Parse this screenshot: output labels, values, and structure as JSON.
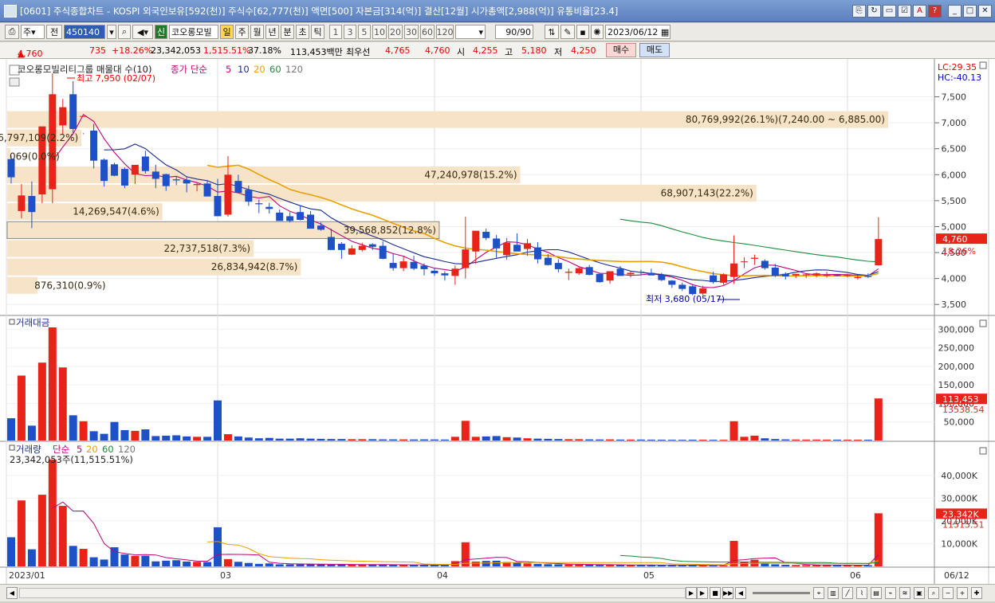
{
  "title": "[0601] 주식종합차트 - KOSPI 외국인보유[592(천)] 주식수[62,777(천)] 액면[500] 자본금[314(억)] 결산[12월] 시가총액[2,988(억)] 유통비율[23.4]",
  "toolbar": {
    "jumun": "주",
    "jeon": "전",
    "code": "450140",
    "market_badge": "신",
    "stock_name": "코오롱모빌",
    "periods": [
      "일",
      "주",
      "월",
      "년",
      "분",
      "초",
      "틱"
    ],
    "intervals": [
      "1",
      "3",
      "5",
      "10",
      "20",
      "30",
      "60",
      "120"
    ],
    "count": "90/90",
    "date": "2023/06/12"
  },
  "info": {
    "price": "4,760",
    "price_arrow": "▲",
    "change": "735",
    "change_pct": "+18.26%",
    "volume": "23,342,053",
    "vol_ratio": "1,515.51%",
    "turnover": "37.18%",
    "amount": "113,453백만",
    "best_label": "최우선",
    "ask": "4,765",
    "bid": "4,760",
    "open_label": "시",
    "open": "4,255",
    "high_label": "고",
    "high": "5,180",
    "low_label": "저",
    "low": "4,250",
    "buy_label": "매수",
    "sell_label": "매도"
  },
  "chart_data": {
    "type": "candlestick",
    "dates": [
      "2023/01",
      "03",
      "04",
      "05",
      "06",
      "06/12"
    ],
    "price_legend": {
      "name": "코오롱모빌리티그룹 매물대 수(10)",
      "ma_label": "종가 단순",
      "ma_periods": [
        "5",
        "10",
        "20",
        "60",
        "120"
      ]
    },
    "price_axis": [
      "7,500",
      "7,000",
      "6,500",
      "6,000",
      "5,500",
      "5,000",
      "4,500",
      "4,000",
      "3,500"
    ],
    "price_range": [
      3350,
      7800
    ],
    "lc": "LC:29.35",
    "hc": "HC:-40.13",
    "high_note": "최고 7,950 (02/07)",
    "low_note": "최저 3,680 (05/17)",
    "current_price": "4,760",
    "current_pct": "18.26%",
    "volume_profile": [
      {
        "label": "80,769,992(26.1%)(7,240.00 ~ 6,885.00)",
        "lo": 6885,
        "hi": 7240,
        "vol": 26.1
      },
      {
        "label": "6,797,109(2.2%)",
        "lo": 6530,
        "hi": 6885,
        "vol": 2.2
      },
      {
        "label": "069(0.0%)",
        "lo": 6175,
        "hi": 6530,
        "vol": 0.0
      },
      {
        "label": "47,240,978(15.2%)",
        "lo": 5820,
        "hi": 6175,
        "vol": 15.2
      },
      {
        "label": "68,907,143(22.2%)",
        "lo": 5465,
        "hi": 5820,
        "vol": 22.2
      },
      {
        "label": "14,269,547(4.6%)",
        "lo": 5110,
        "hi": 5465,
        "vol": 4.6
      },
      {
        "label": "39,568,852(12.8%)",
        "lo": 4755,
        "hi": 5110,
        "vol": 12.8
      },
      {
        "label": "22,737,518(7.3%)",
        "lo": 4400,
        "hi": 4755,
        "vol": 7.3
      },
      {
        "label": "26,834,942(8.7%)",
        "lo": 4045,
        "hi": 4400,
        "vol": 8.7
      },
      {
        "label": "876,310(0.9%)",
        "lo": 3690,
        "hi": 4045,
        "vol": 0.9
      }
    ],
    "candles": [
      [
        6300,
        6370,
        5830,
        5950
      ],
      [
        5300,
        5820,
        5160,
        5600
      ],
      [
        5590,
        5870,
        4970,
        5280
      ],
      [
        5620,
        6930,
        5450,
        6930
      ],
      [
        5720,
        7950,
        5450,
        7550
      ],
      [
        6950,
        7460,
        6780,
        7300
      ],
      [
        7550,
        7800,
        6800,
        6880
      ],
      [
        7120,
        6800,
        6780,
        7130
      ],
      [
        6850,
        6980,
        6120,
        6270
      ],
      [
        6290,
        6310,
        5770,
        5880
      ],
      [
        6200,
        6230,
        5970,
        5980
      ],
      [
        6110,
        6140,
        5740,
        5790
      ],
      [
        6000,
        6120,
        5820,
        6190
      ],
      [
        6350,
        6460,
        6020,
        6070
      ],
      [
        6060,
        6190,
        5740,
        5920
      ],
      [
        6010,
        6020,
        5690,
        5780
      ],
      [
        5910,
        5960,
        5800,
        5890
      ],
      [
        5900,
        5960,
        5660,
        5830
      ],
      [
        5800,
        5850,
        5680,
        5820
      ],
      [
        5830,
        5890,
        5600,
        5580
      ],
      [
        5590,
        5920,
        5240,
        5200
      ],
      [
        5230,
        6360,
        5190,
        6000
      ],
      [
        5880,
        6000,
        5700,
        5650
      ],
      [
        5710,
        5790,
        5400,
        5480
      ],
      [
        5450,
        5520,
        5260,
        5430
      ],
      [
        5380,
        5460,
        5250,
        5340
      ],
      [
        5270,
        5330,
        5120,
        5110
      ],
      [
        5200,
        5280,
        5080,
        5110
      ],
      [
        5280,
        5410,
        5120,
        5130
      ],
      [
        5230,
        5300,
        5060,
        4960
      ],
      [
        5020,
        5080,
        4920,
        4940
      ],
      [
        4800,
        4960,
        4680,
        4550
      ],
      [
        4670,
        4700,
        4380,
        4550
      ],
      [
        4460,
        4640,
        4450,
        4580
      ],
      [
        4550,
        4690,
        4520,
        4630
      ],
      [
        4660,
        4680,
        4550,
        4610
      ],
      [
        4630,
        4720,
        4370,
        4380
      ],
      [
        4300,
        4470,
        4150,
        4200
      ],
      [
        4200,
        4430,
        4140,
        4330
      ],
      [
        4320,
        4440,
        4160,
        4190
      ],
      [
        4250,
        4290,
        4060,
        4180
      ],
      [
        4150,
        4210,
        4050,
        4100
      ],
      [
        4100,
        4140,
        3960,
        4060
      ],
      [
        4050,
        4250,
        3880,
        4190
      ],
      [
        4200,
        5190,
        4000,
        4560
      ],
      [
        4520,
        4870,
        4280,
        4920
      ],
      [
        4900,
        4960,
        4740,
        4780
      ],
      [
        4770,
        4840,
        4400,
        4580
      ],
      [
        4450,
        4780,
        4360,
        4690
      ],
      [
        4650,
        4870,
        4560,
        4520
      ],
      [
        4570,
        4760,
        4440,
        4680
      ],
      [
        4600,
        4700,
        4290,
        4370
      ],
      [
        4400,
        4470,
        4250,
        4260
      ],
      [
        4300,
        4370,
        4120,
        4180
      ],
      [
        4110,
        4190,
        3970,
        4130
      ],
      [
        4100,
        4230,
        4070,
        4200
      ],
      [
        4220,
        4260,
        4060,
        4070
      ],
      [
        4090,
        4110,
        3920,
        3930
      ],
      [
        3960,
        4060,
        3900,
        4140
      ],
      [
        4190,
        4240,
        4050,
        4050
      ],
      [
        4080,
        4140,
        4020,
        4110
      ],
      [
        4130,
        4170,
        4060,
        4120
      ],
      [
        4110,
        4190,
        4070,
        4060
      ],
      [
        4070,
        4110,
        3950,
        3970
      ],
      [
        3960,
        3970,
        3820,
        3880
      ],
      [
        3880,
        3920,
        3760,
        3800
      ],
      [
        3850,
        3890,
        3680,
        3700
      ],
      [
        3710,
        3860,
        3680,
        3810
      ],
      [
        4060,
        4130,
        3900,
        3930
      ],
      [
        3920,
        4100,
        3880,
        4080
      ],
      [
        4030,
        4830,
        3900,
        4290
      ],
      [
        4330,
        4410,
        4200,
        4330
      ],
      [
        4380,
        4460,
        4260,
        4400
      ],
      [
        4340,
        4370,
        4170,
        4200
      ],
      [
        4210,
        4280,
        4030,
        4050
      ],
      [
        4090,
        4120,
        3980,
        4040
      ],
      [
        4060,
        4090,
        4010,
        4090
      ],
      [
        4070,
        4090,
        4010,
        4080
      ],
      [
        4060,
        4120,
        4020,
        4100
      ],
      [
        4050,
        4130,
        4020,
        4070
      ],
      [
        4070,
        4090,
        4040,
        4050
      ],
      [
        4050,
        4090,
        4020,
        4070
      ],
      [
        4010,
        4060,
        3980,
        4030
      ],
      [
        4050,
        4100,
        4010,
        4030
      ],
      [
        4255,
        5180,
        4250,
        4760
      ]
    ],
    "amount": {
      "label": "거래대금",
      "axis": [
        "300,000",
        "250,000",
        "200,000",
        "150,000",
        "100,000",
        "50,000"
      ],
      "max": 320000,
      "current": "113,453",
      "ma": "13538.54",
      "values": [
        60000,
        175000,
        40000,
        210000,
        305000,
        197000,
        68000,
        52000,
        25000,
        18000,
        50000,
        28000,
        26000,
        30000,
        12000,
        13000,
        14000,
        11000,
        10000,
        10000,
        108000,
        17000,
        11000,
        8000,
        6000,
        7000,
        5000,
        5000,
        6000,
        5000,
        4500,
        4000,
        4000,
        3500,
        3500,
        3500,
        3000,
        3000,
        3000,
        2800,
        3000,
        2800,
        2600,
        10000,
        53000,
        10000,
        11000,
        12000,
        9000,
        8000,
        6000,
        5000,
        4500,
        4000,
        3500,
        3500,
        3000,
        2800,
        3000,
        2500,
        2500,
        2500,
        2300,
        2200,
        2000,
        2000,
        2200,
        2100,
        2000,
        2000,
        52000,
        10000,
        13000,
        6000,
        4000,
        3000,
        2600,
        2400,
        2500,
        2300,
        2300,
        2200,
        2100,
        2200,
        113453
      ]
    },
    "volume": {
      "label": "거래량",
      "ma_label": "단순",
      "ma_periods": [
        "5",
        "20",
        "60",
        "120"
      ],
      "sub": "23,342,053주(11,515.51%)",
      "axis": [
        "40,000K",
        "30,000K",
        "20,000K",
        "10,000K"
      ],
      "max": 48000,
      "current": "23,342K",
      "ma": "11515.51",
      "values": [
        12800,
        29000,
        7500,
        31500,
        47000,
        26600,
        9000,
        7700,
        4000,
        3000,
        8400,
        5200,
        4600,
        4700,
        2200,
        2500,
        2700,
        2100,
        2000,
        1900,
        17200,
        3200,
        2000,
        1500,
        1100,
        1300,
        900,
        900,
        1000,
        950,
        900,
        800,
        850,
        750,
        740,
        760,
        700,
        680,
        640,
        600,
        650,
        600,
        560,
        2300,
        10600,
        2100,
        2400,
        2500,
        1900,
        1800,
        1300,
        1100,
        950,
        900,
        820,
        780,
        700,
        650,
        700,
        600,
        590,
        600,
        560,
        520,
        490,
        480,
        520,
        510,
        480,
        480,
        11200,
        2100,
        2900,
        1400,
        900,
        700,
        620,
        560,
        590,
        540,
        540,
        520,
        500,
        520,
        23342
      ]
    }
  },
  "bottom": {}
}
